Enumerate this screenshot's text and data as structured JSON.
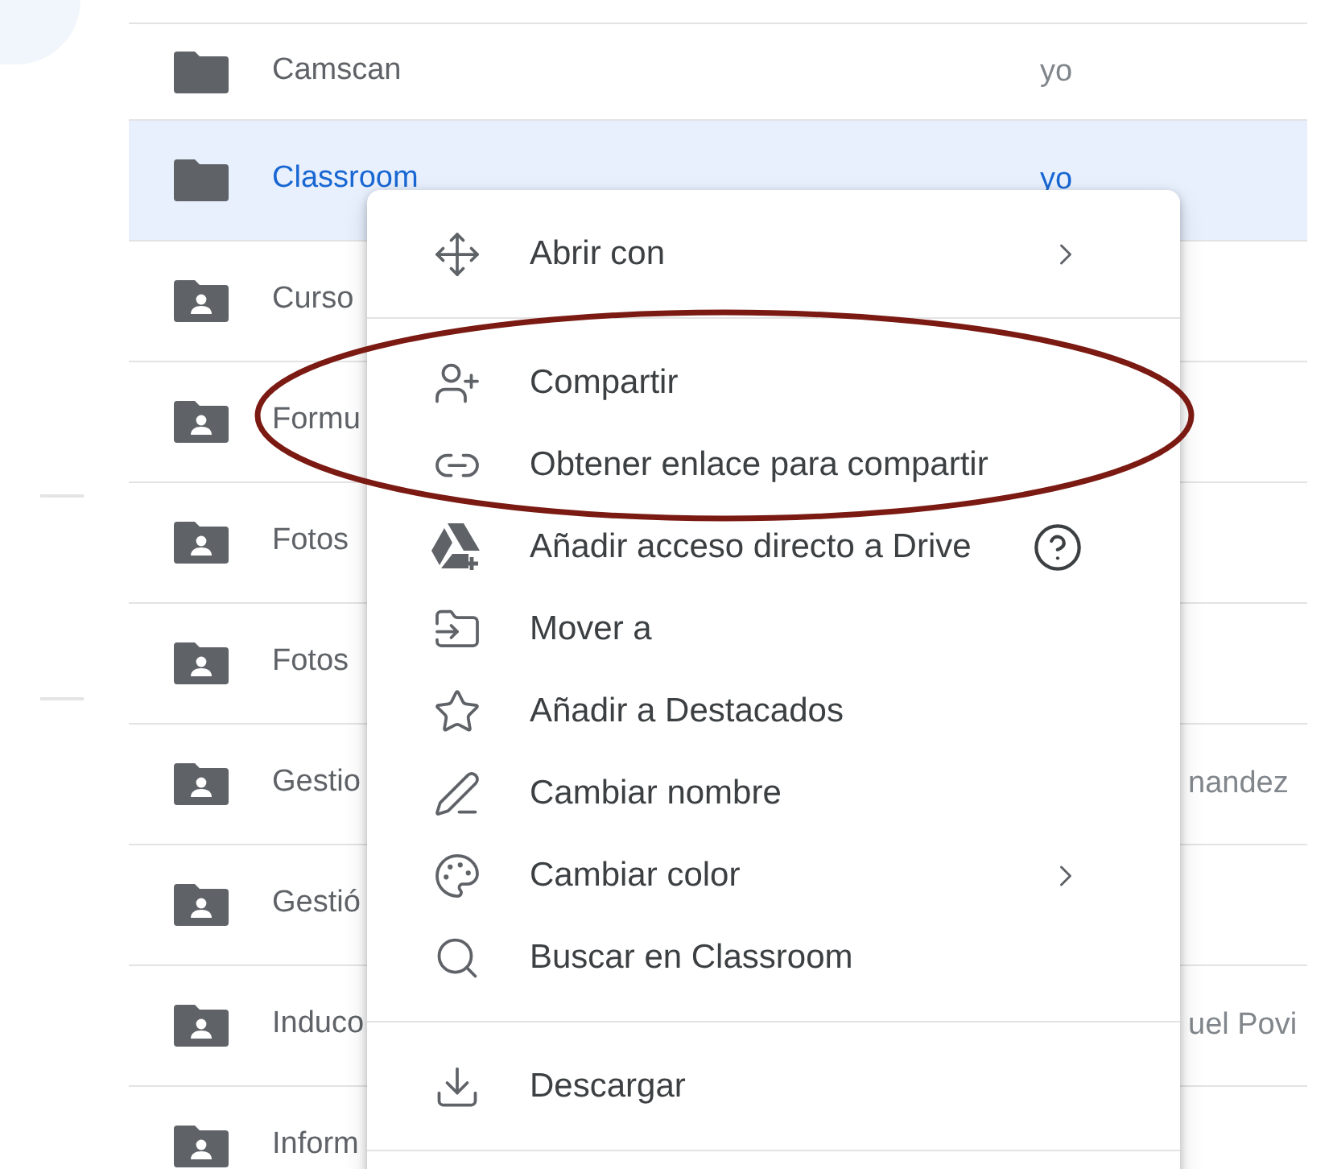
{
  "files": [
    {
      "name": "Camscan",
      "owner": "yo",
      "kind": "plain",
      "selected": false
    },
    {
      "name": "Classroom",
      "owner": "yo",
      "kind": "plain",
      "selected": true
    },
    {
      "name": "Curso",
      "kind": "shared",
      "selected": false
    },
    {
      "name": "Formu",
      "kind": "shared",
      "selected": false
    },
    {
      "name": "Fotos",
      "kind": "shared",
      "selected": false
    },
    {
      "name": "Fotos",
      "kind": "shared",
      "selected": false
    },
    {
      "name": "Gestio",
      "owner": "nandez",
      "kind": "shared",
      "selected": false
    },
    {
      "name": "Gestió",
      "kind": "shared",
      "selected": false
    },
    {
      "name": "Induco",
      "owner": "uel Povi",
      "kind": "shared",
      "selected": false
    },
    {
      "name": "Inform",
      "kind": "shared",
      "selected": false
    }
  ],
  "context_menu": {
    "sections": [
      [
        {
          "label": "Abrir con",
          "kind": "move",
          "submenu": true,
          "help": false
        }
      ],
      [
        {
          "label": "Compartir",
          "kind": "share",
          "submenu": false,
          "help": false
        },
        {
          "label": "Obtener enlace para compartir",
          "kind": "link",
          "submenu": false,
          "help": false
        },
        {
          "label": "Añadir acceso directo a Drive",
          "kind": "drive",
          "submenu": false,
          "help": true
        },
        {
          "label": "Mover a",
          "kind": "move-to",
          "submenu": false,
          "help": false
        },
        {
          "label": "Añadir a Destacados",
          "kind": "star",
          "submenu": false,
          "help": false
        },
        {
          "label": "Cambiar nombre",
          "kind": "rename",
          "submenu": false,
          "help": false
        },
        {
          "label": "Cambiar color",
          "kind": "palette",
          "submenu": true,
          "help": false
        },
        {
          "label": "Buscar en Classroom",
          "kind": "search",
          "submenu": false,
          "help": false
        }
      ],
      [
        {
          "label": "Descargar",
          "kind": "download",
          "submenu": false,
          "help": false
        }
      ]
    ]
  },
  "annotation": {
    "kind": "ellipse",
    "color": "#7b1a12"
  }
}
